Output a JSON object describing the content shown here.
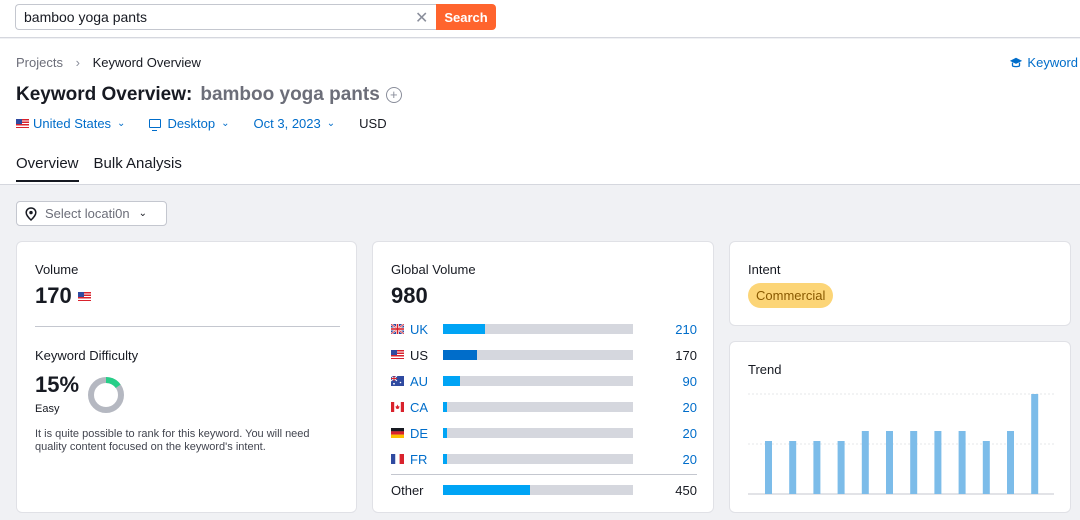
{
  "search": {
    "value": "bamboo yoga pants",
    "button_label": "Search"
  },
  "breadcrumb": {
    "root": "Projects",
    "current": "Keyword Overview"
  },
  "kw_link_label": "Keyword",
  "title": {
    "prefix": "Keyword Overview:",
    "keyword": "bamboo yoga pants"
  },
  "filters": {
    "country": "United States",
    "device": "Desktop",
    "date": "Oct 3, 2023",
    "currency": "USD"
  },
  "tabs": [
    "Overview",
    "Bulk Analysis"
  ],
  "location_select": {
    "placeholder": "Select locati0n"
  },
  "volume": {
    "label": "Volume",
    "value": "170"
  },
  "difficulty": {
    "label": "Keyword Difficulty",
    "value": "15%",
    "level": "Easy",
    "percent": 15,
    "description": "It is quite possible to rank for this keyword. You will need quality content focused on the keyword's intent."
  },
  "global_volume": {
    "label": "Global Volume",
    "value": "980",
    "rows": [
      {
        "country": "UK",
        "value": "210",
        "fraction": 0.22,
        "bar_color": "#00a4f5",
        "linked": true
      },
      {
        "country": "US",
        "value": "170",
        "fraction": 0.18,
        "bar_color": "#006dca",
        "linked": false
      },
      {
        "country": "AU",
        "value": "90",
        "fraction": 0.09,
        "bar_color": "#00a4f5",
        "linked": true
      },
      {
        "country": "CA",
        "value": "20",
        "fraction": 0.02,
        "bar_color": "#00a4f5",
        "linked": true
      },
      {
        "country": "DE",
        "value": "20",
        "fraction": 0.02,
        "bar_color": "#00a4f5",
        "linked": true
      },
      {
        "country": "FR",
        "value": "20",
        "fraction": 0.02,
        "bar_color": "#00a4f5",
        "linked": true
      }
    ],
    "other": {
      "label": "Other",
      "value": "450",
      "fraction": 0.46
    }
  },
  "intent": {
    "label": "Intent",
    "value": "Commercial"
  },
  "trend": {
    "label": "Trend",
    "values": [
      0.53,
      0.53,
      0.53,
      0.53,
      0.63,
      0.63,
      0.63,
      0.63,
      0.63,
      0.53,
      0.63,
      1.0
    ]
  },
  "colors": {
    "accent": "#ff642d",
    "link": "#006dca",
    "bar": "#00a4f5",
    "trend_bar": "#7cbce9",
    "intent_badge": "#fcd577",
    "difficulty": "#27ce88"
  }
}
